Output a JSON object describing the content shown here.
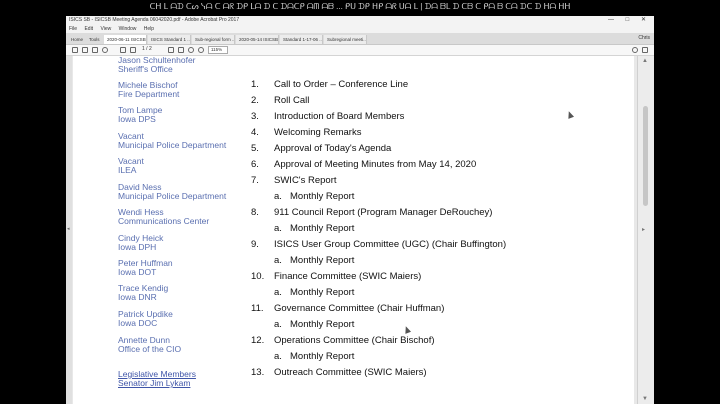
{
  "caption": "ᑕᕼ ᒪ ᗩᗪ ᑕᔕ ᓭᗩ ᑕ ᗩᖇ ᗪᑭ ᒪᗩ ᗪ ᑕ ᗪᗩᑕᑭ ᗩᗰ ᗩᗷ ... ᑭᑌ ᗪᑭ ᕼᑭ ᗩᖇ ᑌᗩ ᒪ | ᗪᗩ ᗷᒪ ᗪ ᑕᗷ ᑕ ᑭᗩ ᗷ ᑕᗩ ᗪᑕ ᗪ ᕼᗩ ᕼᕼ",
  "window": {
    "title": "ISICS SB - ISICSB Meeting Agenda 06042020.pdf - Adobe Acrobat Pro 2017",
    "controls": "— □ ✕"
  },
  "menu": [
    "File",
    "Edit",
    "View",
    "Window",
    "Help"
  ],
  "tabs": {
    "home": "Home",
    "tools": "Tools",
    "docs": [
      "2020-06-11 ISICSB ...",
      "ISICS Standard 1 ...",
      "Sub-regional form ...",
      "2020-05-14 ISICSB ...",
      "Standard 1-17-06 ...",
      "Subregional meeti..."
    ],
    "user": "Chris"
  },
  "toolbar": {
    "zoom": "115%",
    "page_info": "1 / 2"
  },
  "members": [
    {
      "name": "Jason Schultenhofer",
      "org": "Sheriff's Office"
    },
    {
      "name": "Michele Bischof",
      "org": "Fire Department"
    },
    {
      "name": "Tom Lampe",
      "org": "Iowa DPS"
    },
    {
      "name": "Vacant",
      "org": "Municipal Police Department"
    },
    {
      "name": "Vacant",
      "org": "ILEA"
    },
    {
      "name": "David Ness",
      "org": "Municipal Police Department"
    },
    {
      "name": "Wendi Hess",
      "org": "Communications Center"
    },
    {
      "name": "Cindy Heick",
      "org": "Iowa DPH"
    },
    {
      "name": "Peter Huffman",
      "org": "Iowa DOT"
    },
    {
      "name": "Trace Kendig",
      "org": "Iowa DNR"
    },
    {
      "name": "Patrick Updike",
      "org": "Iowa DOC"
    },
    {
      "name": "Annette Dunn",
      "org": "Office of the CIO"
    }
  ],
  "legislative": {
    "heading": "Legislative Members",
    "name": "Senator Jim Lykam"
  },
  "agenda": [
    {
      "num": "1.",
      "text": "Call to Order – Conference Line"
    },
    {
      "num": "2.",
      "text": "Roll Call"
    },
    {
      "num": "3.",
      "text": "Introduction of Board Members"
    },
    {
      "num": "4.",
      "text": "Welcoming Remarks"
    },
    {
      "num": "5.",
      "text": "Approval of Today's Agenda"
    },
    {
      "num": "6.",
      "text": "Approval of Meeting Minutes from May 14, 2020"
    },
    {
      "num": "7.",
      "text": "SWIC's Report",
      "sub": "Monthly Report"
    },
    {
      "num": "8.",
      "text": "911 Council Report (Program Manager DeRouchey)",
      "sub": "Monthly Report"
    },
    {
      "num": "9.",
      "text": "ISICS User Group Committee (UGC) (Chair Buffington)",
      "sub": "Monthly Report"
    },
    {
      "num": "10.",
      "text": "Finance Committee (SWIC Maiers)",
      "sub": "Monthly Report"
    },
    {
      "num": "11.",
      "text": "Governance Committee (Chair Huffman)",
      "sub": "Monthly Report"
    },
    {
      "num": "12.",
      "text": "Operations Committee (Chair Bischof)",
      "sub": "Monthly Report"
    },
    {
      "num": "13.",
      "text": "Outreach Committee (SWIC Maiers)"
    }
  ],
  "sub_letter": "a.",
  "icons": [
    "save-icon",
    "print-icon",
    "email-icon",
    "search-icon",
    "page-up-icon",
    "page-down-icon",
    "select-icon",
    "hand-icon",
    "zoom-out-icon",
    "zoom-in-icon",
    "help-icon",
    "bell-icon"
  ],
  "colors": {
    "member_text": "#5a6fb0",
    "doc_text": "#111111",
    "frame": "#000000"
  }
}
